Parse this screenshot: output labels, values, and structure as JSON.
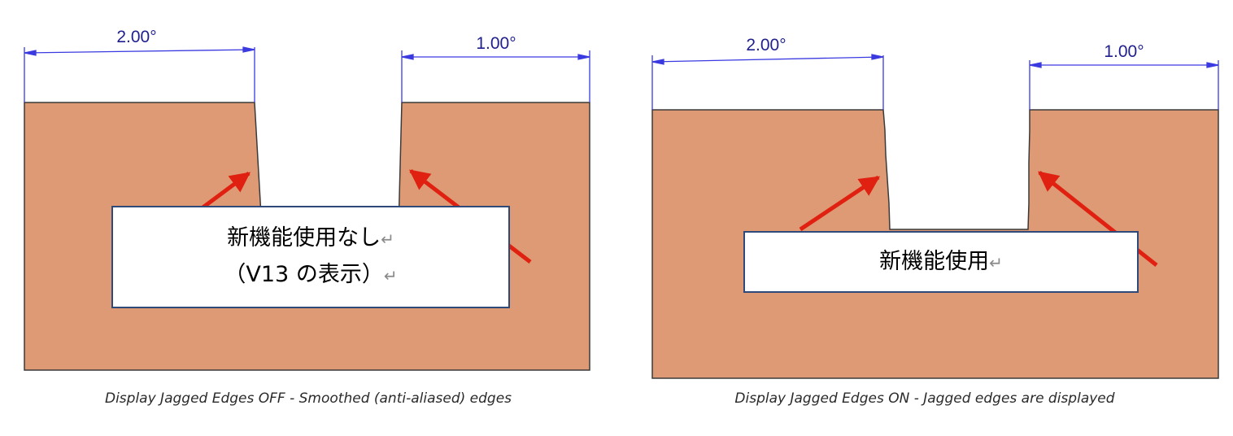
{
  "panels": [
    {
      "id": "left",
      "dim_left": "2.00°",
      "dim_right": "1.00°",
      "callout_lines": [
        "新機能使用なし",
        "（V13 の表示）"
      ],
      "caption": "Display Jagged Edges OFF - Smoothed (anti-aliased) edges"
    },
    {
      "id": "right",
      "dim_left": "2.00°",
      "dim_right": "1.00°",
      "callout_lines": [
        "新機能使用"
      ],
      "caption": "Display Jagged Edges ON - Jagged edges are displayed"
    }
  ],
  "colors": {
    "block_fill": "#dd9a74",
    "block_stroke": "#3a3a3a",
    "dimension": "#3a3ae0",
    "arrow": "#e02010",
    "callout_border": "#2f4a7a"
  },
  "return_mark": "↵"
}
